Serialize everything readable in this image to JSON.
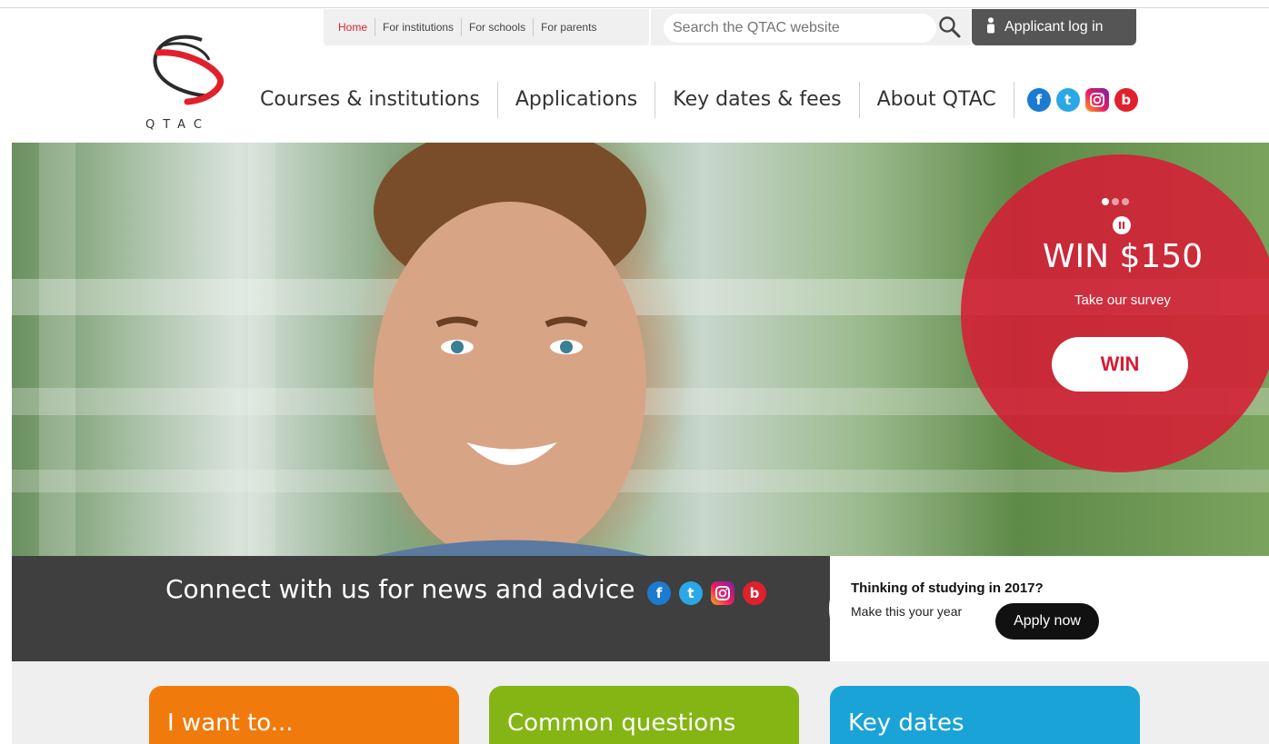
{
  "util_nav": {
    "tabs": [
      {
        "label": "Home",
        "active": true
      },
      {
        "label": "For institutions"
      },
      {
        "label": "For schools"
      },
      {
        "label": "For parents"
      }
    ],
    "search_placeholder": "Search the QTAC website",
    "search_icon": "search-icon",
    "login_label": "Applicant log in"
  },
  "logo": {
    "text": "QTAC"
  },
  "main_nav": {
    "items": [
      {
        "label": "Courses & institutions"
      },
      {
        "label": "Applications"
      },
      {
        "label": "Key dates & fees"
      },
      {
        "label": "About QTAC"
      }
    ],
    "social": [
      {
        "icon": "facebook-icon",
        "glyph": "f"
      },
      {
        "icon": "tumblr-icon",
        "glyph": "t"
      },
      {
        "icon": "instagram-icon",
        "glyph": ""
      },
      {
        "icon": "blog-icon",
        "glyph": "b"
      }
    ]
  },
  "hero": {
    "slide_count": 3,
    "active_slide": 1,
    "title": "WIN $150",
    "subtitle": "Take our survey",
    "button_label": "WIN"
  },
  "connect": {
    "text": "Connect with us for news and advice"
  },
  "study": {
    "title": "Thinking of studying in 2017?",
    "subtitle": "Make this your year",
    "button_label": "Apply now"
  },
  "cards": [
    {
      "label": "I want to..."
    },
    {
      "label": "Common questions"
    },
    {
      "label": "Key dates"
    }
  ],
  "colors": {
    "brand_red": "#d22630",
    "orange": "#f07b0c",
    "green": "#84b515",
    "blue": "#1aa3d6"
  }
}
